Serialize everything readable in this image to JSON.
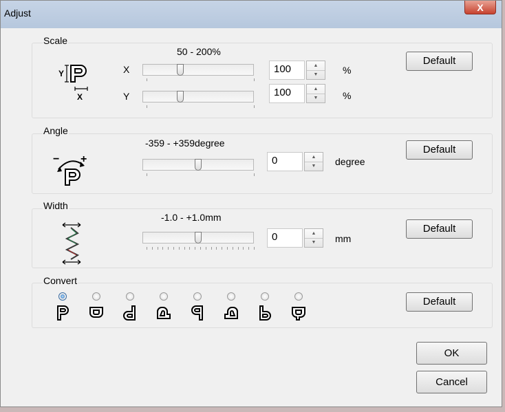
{
  "window": {
    "title": "Adjust",
    "close_label": "X"
  },
  "scale": {
    "group_label": "Scale",
    "range": "50 - 200%",
    "x": {
      "axis": "X",
      "value": "100",
      "unit": "%",
      "level_pct": 33
    },
    "y": {
      "axis": "Y",
      "value": "100",
      "unit": "%",
      "level_pct": 33
    },
    "default_label": "Default"
  },
  "angle": {
    "group_label": "Angle",
    "range": "-359 - +359degree",
    "value": "0",
    "unit": "degree",
    "level_pct": 50,
    "default_label": "Default"
  },
  "width": {
    "group_label": "Width",
    "range": "-1.0 - +1.0mm",
    "value": "0",
    "unit": "mm",
    "level_pct": 50,
    "default_label": "Default"
  },
  "convert": {
    "group_label": "Convert",
    "selected_index": 0,
    "options": [
      "p-normal",
      "p-flip-vertical",
      "p-flip-horizontal-d",
      "p-rotate-left",
      "p-mirror-q",
      "p-rotate-right",
      "p-mirror-b",
      "p-rotate-180"
    ],
    "default_label": "Default"
  },
  "footer": {
    "ok_label": "OK",
    "cancel_label": "Cancel"
  },
  "icons": {
    "scale_icon": "scale-p-icon",
    "angle_icon": "rotate-p-icon",
    "width_icon": "zigzag-width-icon"
  },
  "colors": {
    "accent": "#1c64b4",
    "close": "#c7432f"
  }
}
